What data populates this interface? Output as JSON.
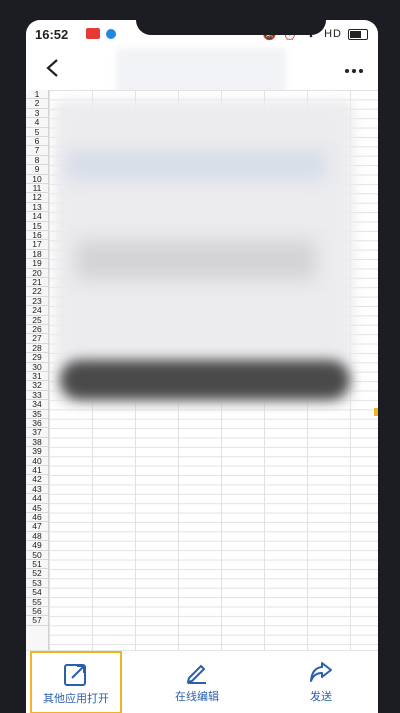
{
  "status_bar": {
    "time": "16:52",
    "network": "HD"
  },
  "header": {
    "back_icon": "chevron-left-icon",
    "more_icon": "more-dots-icon"
  },
  "sheet": {
    "row_numbers": [
      "1",
      "2",
      "3",
      "4",
      "5",
      "6",
      "7",
      "8",
      "9",
      "10",
      "11",
      "12",
      "13",
      "14",
      "15",
      "16",
      "17",
      "18",
      "19",
      "20",
      "21",
      "22",
      "23",
      "24",
      "25",
      "26",
      "27",
      "28",
      "29",
      "30",
      "31",
      "32",
      "33",
      "34",
      "35",
      "36",
      "37",
      "38",
      "39",
      "40",
      "41",
      "42",
      "43",
      "44",
      "45",
      "46",
      "47",
      "48",
      "49",
      "50",
      "51",
      "52",
      "53",
      "54",
      "55",
      "56",
      "57"
    ]
  },
  "bottom_bar": {
    "open_other_label": "其他应用打开",
    "edit_online_label": "在线编辑",
    "send_label": "发送",
    "accent_color": "#2a5fae",
    "highlight_color": "#f0b322"
  }
}
